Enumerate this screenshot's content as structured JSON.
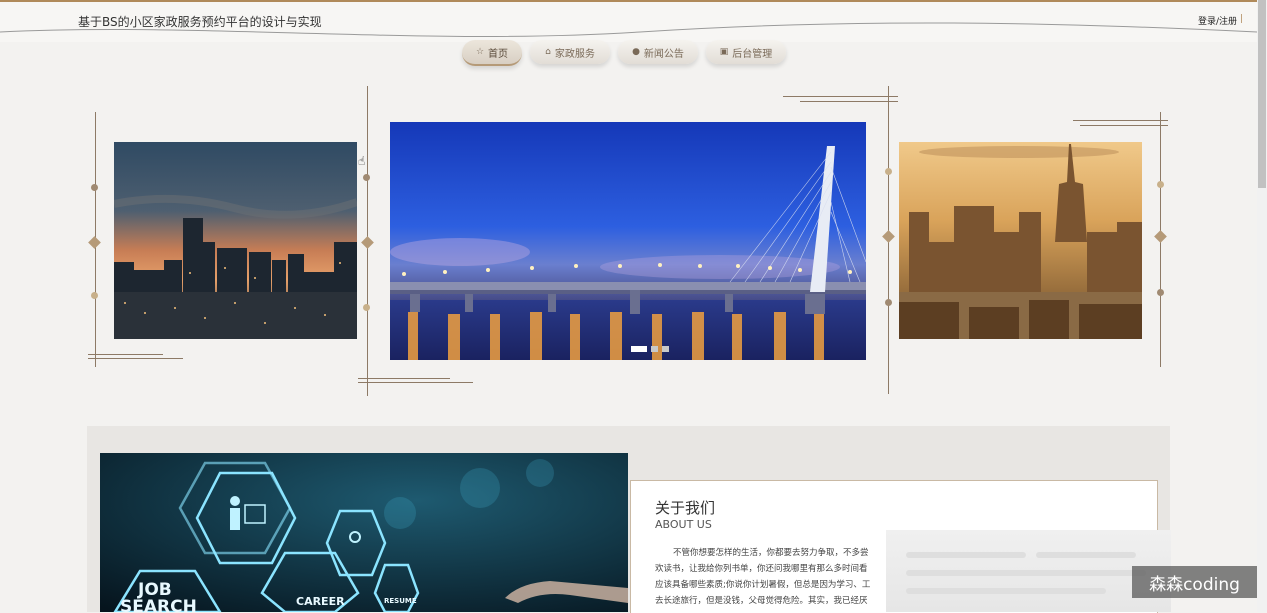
{
  "header": {
    "title": "基于BS的小区家政服务预约平台的设计与实现",
    "login_label": "登录/注册"
  },
  "nav": {
    "items": [
      {
        "label": "首页",
        "icon": "star-icon",
        "glyph": "☆"
      },
      {
        "label": "家政服务",
        "icon": "bag-icon",
        "glyph": "⌂"
      },
      {
        "label": "新闻公告",
        "icon": "info-icon",
        "glyph": "●"
      },
      {
        "label": "后台管理",
        "icon": "briefcase-icon",
        "glyph": "▣"
      }
    ],
    "active_index": 0
  },
  "carousel": {
    "slides": [
      "city-dusk-skyline",
      "illuminated-cable-bridge",
      "golden-city-towers"
    ],
    "active_slide": 1,
    "slide_count": 3
  },
  "about": {
    "title": "关于我们",
    "subtitle": "ABOUT US",
    "paragraph_lines": [
      "不管你想要怎样的生活，你都要去努力争取，不多尝",
      "欢读书，让我给你列书单，你还问我哪里有那么多时间看",
      "应该具备哪些素质;你说你计划暑假，但总是因为学习、工",
      "去长途旅行，但是没钱，父母觉得危险。其实，我已经厌"
    ],
    "image_labels": {
      "job": "JOB",
      "search": "SEARCH",
      "career": "CAREER",
      "resume": "RESUME"
    }
  },
  "watermark": {
    "text": "森森coding"
  },
  "colors": {
    "accent": "#b08a5a",
    "nav_text": "#7a6a58",
    "background": "#f3f2f0"
  }
}
